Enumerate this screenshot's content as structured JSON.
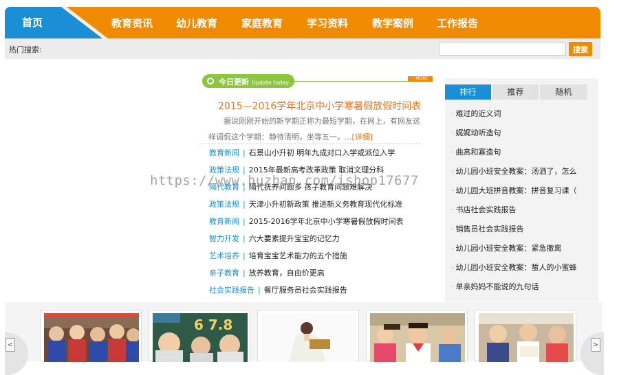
{
  "nav": {
    "home": "首页",
    "items": [
      "教育资讯",
      "幼儿教育",
      "家庭教育",
      "学习资料",
      "教学案例",
      "工作报告"
    ],
    "brand_color": "#f08a00",
    "home_color": "#1a8fd6"
  },
  "search": {
    "label": "热门搜索:",
    "value": "",
    "button": "搜索"
  },
  "update": {
    "title": "今日更新",
    "subtitle": "Update today",
    "more": "› MORE",
    "headline": "2015—2016学年北京中小学寒暑假放假时间表",
    "summary": "据说刚刚开始的新学期正称为最短学期，在网上，有网友这样调侃这个学期：静待清明，坐等五一，...",
    "detail_link": "[详细]"
  },
  "news": [
    {
      "category": "教育新闻",
      "sep": "|",
      "title": "石景山小升初 明年九成对口入学或派位入学"
    },
    {
      "category": "政策法规",
      "sep": "|",
      "title": "2015年最新高考改革政策 取消文理分科"
    },
    {
      "category": "隔代教育",
      "sep": "|",
      "title": "隔代抚养问题多 孩子教育问题难解决"
    },
    {
      "category": "政策法规",
      "sep": "|",
      "title": "天津小升初新政策 推进新义务教育现代化标准"
    },
    {
      "category": "教育新闻",
      "sep": "|",
      "title": "2015-2016学年北京中小学寒暑假放假时间表"
    },
    {
      "category": "智力开发",
      "sep": "|",
      "title": "六大要素提升宝宝的记忆力"
    },
    {
      "category": "艺术培养",
      "sep": "|",
      "title": "培育宝宝艺术能力的五个措施"
    },
    {
      "category": "亲子教育",
      "sep": "|",
      "title": "放养教育，自由价更高"
    },
    {
      "category": "社会实践报告",
      "sep": "|",
      "title": "餐厅服务员社会实践报告"
    }
  ],
  "rank": {
    "tabs": [
      "排行",
      "推荐",
      "随机"
    ],
    "active_tab": "排行",
    "bullet": "·",
    "items": [
      "难过的近义词",
      "娓娓动听造句",
      "曲高和寡造句",
      "幼儿园小班安全教案：汤洒了，怎么",
      "幼儿园大班拼音教案：拼音复习课（",
      "书店社会实践报告",
      "销售员社会实践报告",
      "幼儿园小班安全教案：紧急撤离",
      "幼儿园小班安全教案：蜇人的小蜜蜂",
      "单亲妈妈不能说的九句话"
    ]
  },
  "watermark": "https://www.huzhan.com/ishop17677",
  "carousel": {
    "prev_icon": "chevron-left-icon",
    "next_icon": "chevron-right-icon",
    "prev": "<",
    "next": ">"
  }
}
